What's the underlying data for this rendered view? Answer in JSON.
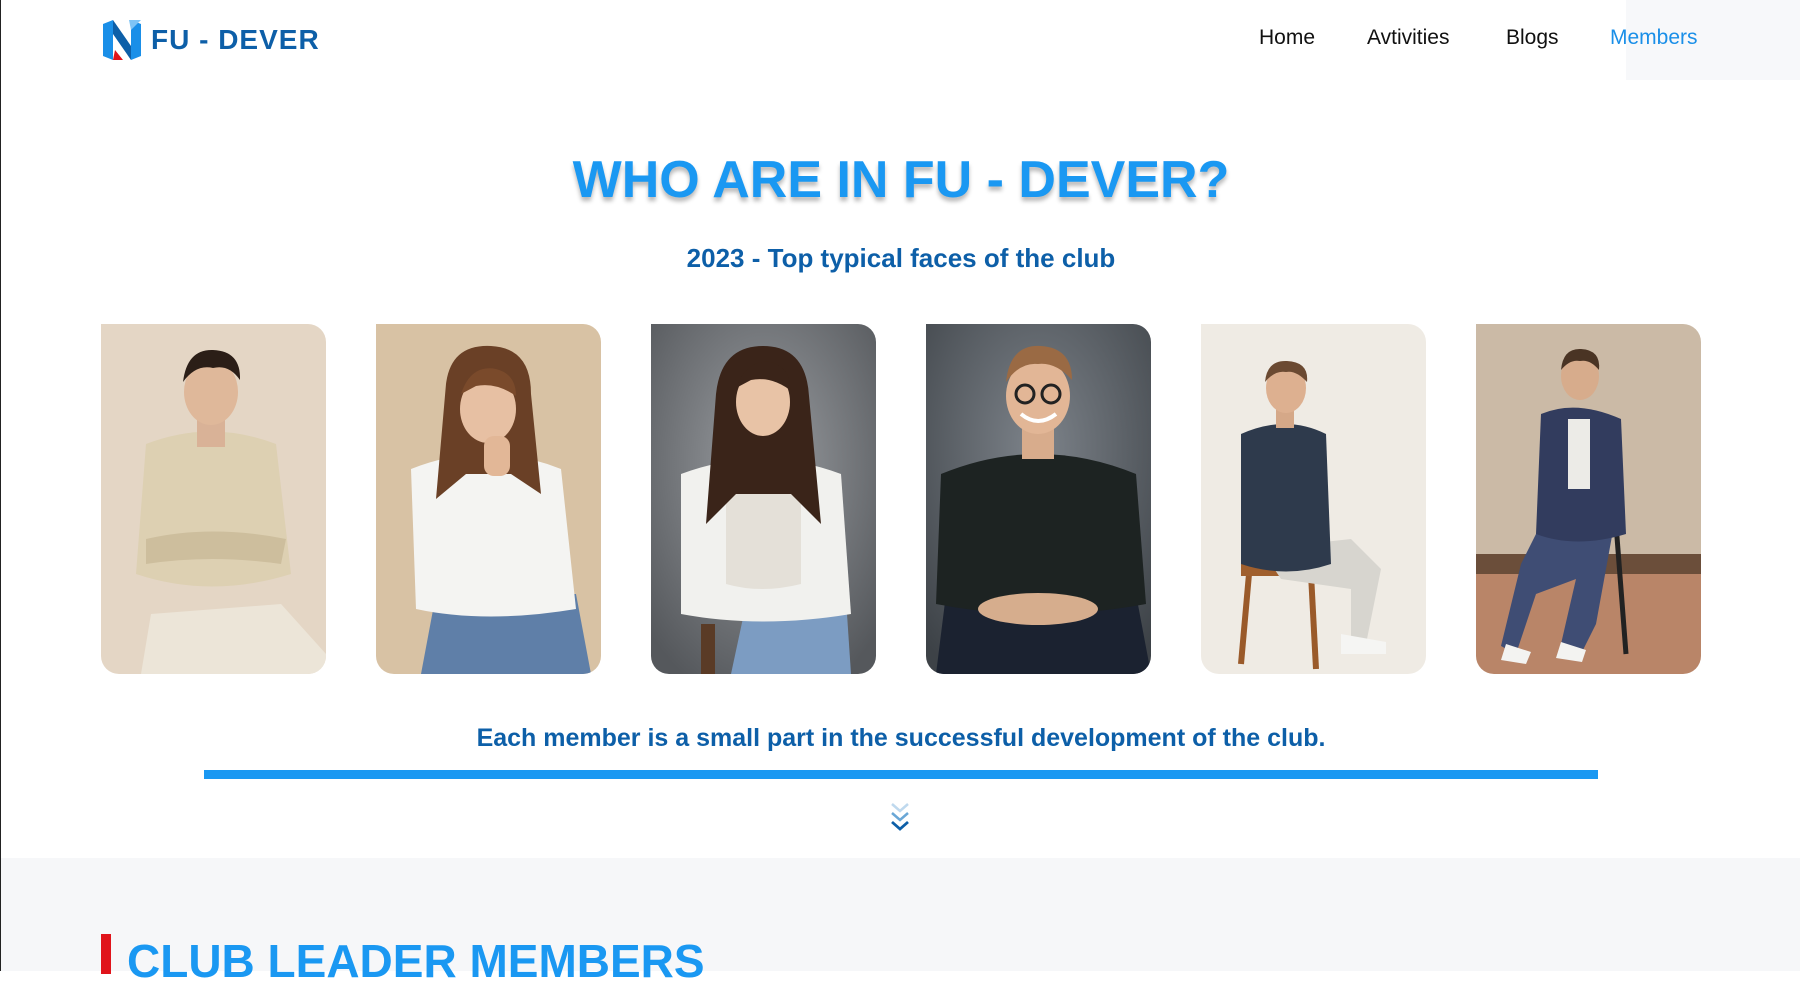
{
  "header": {
    "logo_text": "FU - DEVER",
    "nav": [
      {
        "label": "Home",
        "active": false
      },
      {
        "label": "Avtivities",
        "active": false
      },
      {
        "label": "Blogs",
        "active": false
      },
      {
        "label": "Members",
        "active": true
      }
    ]
  },
  "hero": {
    "title": "WHO ARE IN FU - DEVER?",
    "subtitle": "2023 - Top typical faces of the club"
  },
  "members_gallery": [
    {
      "photo": "young man, cream knit sweater, arms crossed, seated on stool"
    },
    {
      "photo": "woman, white shirt, hand at chin, seated"
    },
    {
      "photo": "woman, white blazer, arms crossed, seated"
    },
    {
      "photo": "smiling man, glasses, black sweater, seated"
    },
    {
      "photo": "man, navy shirt, seated on wooden chair"
    },
    {
      "photo": "man, navy suit, seated on bar stool"
    }
  ],
  "tagline": "Each member is a small part in the successful development of the club.",
  "scroll_icon": "chevrons-down-icon",
  "leaders_section": {
    "title": "CLUB LEADER MEMBERS"
  },
  "colors": {
    "accent": "#1a98f2",
    "dark_blue": "#0d5fa8",
    "marker_red": "#e0141b"
  }
}
